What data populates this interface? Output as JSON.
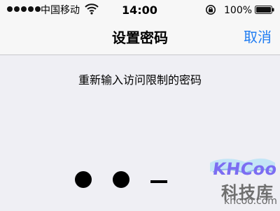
{
  "status_bar": {
    "carrier": "中国移动",
    "time": "14:00",
    "battery": "100%",
    "signal_strength": 5,
    "icons": [
      "wifi-icon",
      "rotation-lock-icon",
      "battery-icon"
    ]
  },
  "nav": {
    "title": "设置密码",
    "cancel_label": "取消",
    "accent_color": "#1f7cf2"
  },
  "passcode": {
    "prompt": "重新输入访问限制的密码",
    "entered_digits": 2,
    "remaining_placeholder": "–"
  },
  "watermark": {
    "brand": "KHCoo",
    "title": "科技库",
    "url": "khcoo.com"
  }
}
